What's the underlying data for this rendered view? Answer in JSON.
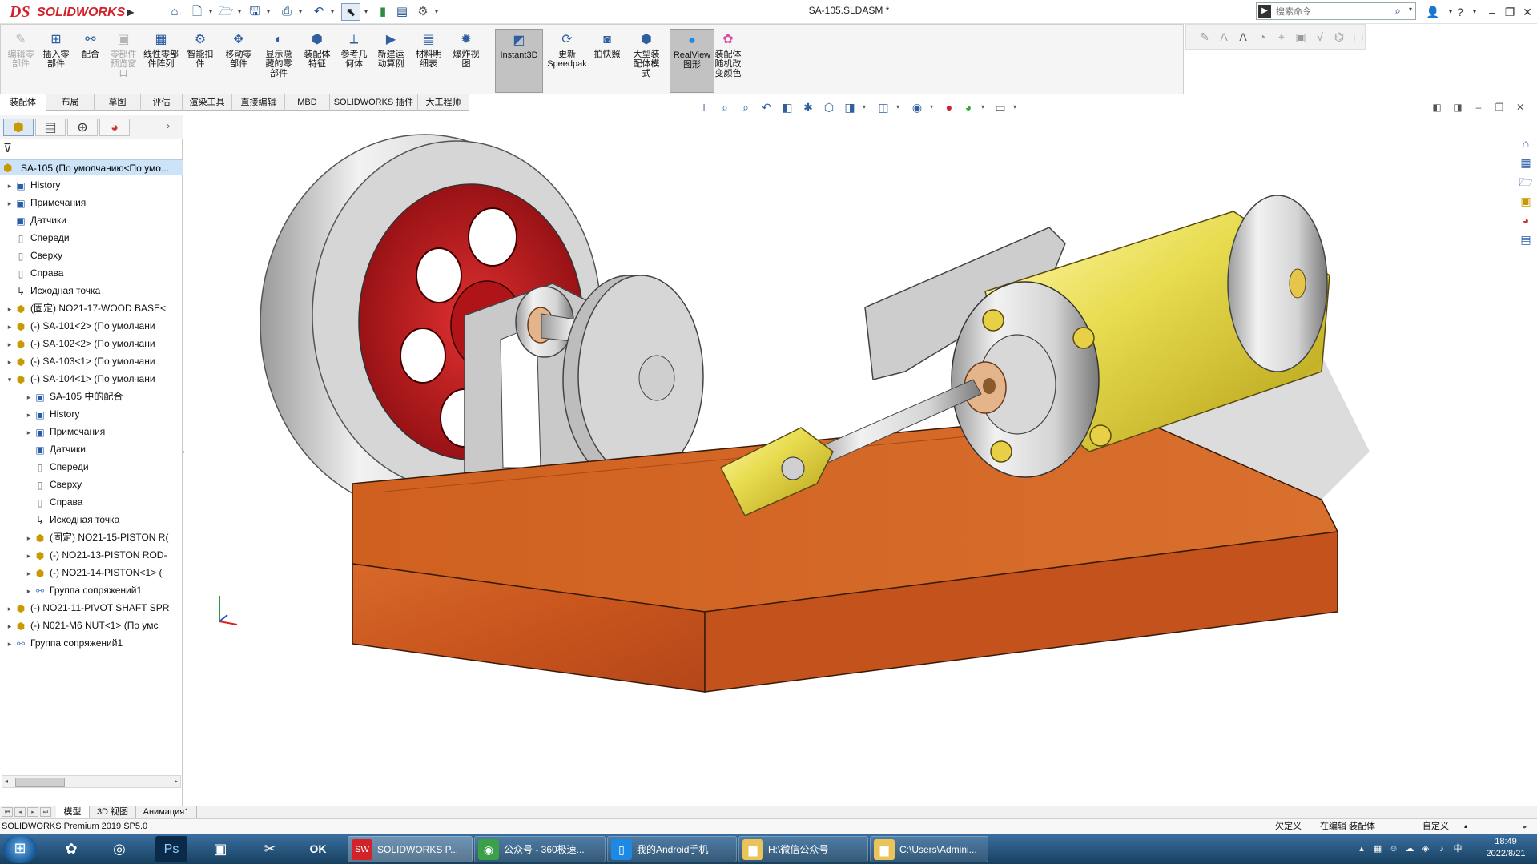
{
  "window": {
    "brand_ds": "DS",
    "brand_name": "SOLIDWORKS",
    "document_title": "SA-105.SLDASM *",
    "search_placeholder": "搜索命令"
  },
  "command_manager": {
    "buttons": [
      {
        "label": "编辑零\n部件",
        "icon": "edit-component-icon",
        "disabled": true
      },
      {
        "label": "插入零\n部件",
        "icon": "insert-component-icon",
        "disabled": false
      },
      {
        "label": "配合",
        "icon": "mate-icon",
        "disabled": false
      },
      {
        "label": "零部件\n预览窗\n口",
        "icon": "component-preview-icon",
        "disabled": true
      },
      {
        "label": "线性零部\n件阵列",
        "icon": "linear-pattern-icon",
        "disabled": false
      },
      {
        "label": "智能扣\n件",
        "icon": "smart-fasteners-icon",
        "disabled": false
      },
      {
        "label": "移动零\n部件",
        "icon": "move-component-icon",
        "disabled": false
      },
      {
        "label": "显示隐\n藏的零\n部件",
        "icon": "show-hidden-icon",
        "disabled": false
      },
      {
        "label": "装配体\n特征",
        "icon": "assembly-features-icon",
        "disabled": false
      },
      {
        "label": "参考几\n何体",
        "icon": "reference-geometry-icon",
        "disabled": false
      },
      {
        "label": "新建运\n动算例",
        "icon": "motion-study-icon",
        "disabled": false
      },
      {
        "label": "材料明\n细表",
        "icon": "bom-icon",
        "disabled": false
      },
      {
        "label": "爆炸视\n图",
        "icon": "exploded-view-icon",
        "disabled": false
      },
      {
        "label": "Instant3D",
        "icon": "instant3d-icon",
        "disabled": false,
        "active": true
      },
      {
        "label": "更新\nSpeedpak",
        "icon": "speedpak-icon",
        "disabled": false
      },
      {
        "label": "拍快照",
        "icon": "snapshot-icon",
        "disabled": false
      },
      {
        "label": "大型装\n配体模\n式",
        "icon": "large-assembly-icon",
        "disabled": false
      },
      {
        "label": "RealView\n图形",
        "icon": "realview-icon",
        "disabled": false,
        "active": true
      },
      {
        "label": "装配体\n随机改\n变颜色",
        "icon": "random-color-icon",
        "disabled": false
      }
    ]
  },
  "tabs": [
    "装配体",
    "布局",
    "草图",
    "评估",
    "渲染工具",
    "直接编辑",
    "MBD",
    "SOLIDWORKS 插件",
    "大工程师"
  ],
  "feature_tree": {
    "root": "SA-105  (По умолчанию<По умо...",
    "items": [
      {
        "label": "History",
        "icon": "folder",
        "level": 1,
        "exp": "▸"
      },
      {
        "label": "Примечания",
        "icon": "folder",
        "level": 1,
        "exp": "▸"
      },
      {
        "label": "Датчики",
        "icon": "folder",
        "level": 1,
        "exp": ""
      },
      {
        "label": "Спереди",
        "icon": "plane",
        "level": 1,
        "exp": ""
      },
      {
        "label": "Сверху",
        "icon": "plane",
        "level": 1,
        "exp": ""
      },
      {
        "label": "Справа",
        "icon": "plane",
        "level": 1,
        "exp": ""
      },
      {
        "label": "Исходная точка",
        "icon": "origin",
        "level": 1,
        "exp": ""
      },
      {
        "label": "(固定) NO21-17-WOOD BASE<",
        "icon": "part",
        "level": 1,
        "exp": "▸"
      },
      {
        "label": "(-) SA-101<2> (По умолчани",
        "icon": "asm",
        "level": 1,
        "exp": "▸"
      },
      {
        "label": "(-) SA-102<2> (По умолчани",
        "icon": "asm",
        "level": 1,
        "exp": "▸"
      },
      {
        "label": "(-) SA-103<1> (По умолчани",
        "icon": "asm",
        "level": 1,
        "exp": "▸"
      },
      {
        "label": "(-) SA-104<1> (По умолчани",
        "icon": "asm",
        "level": 1,
        "exp": "▾"
      },
      {
        "label": "SA-105 中的配合",
        "icon": "folder",
        "level": 2,
        "exp": "▸"
      },
      {
        "label": "History",
        "icon": "folder",
        "level": 2,
        "exp": "▸"
      },
      {
        "label": "Примечания",
        "icon": "folder",
        "level": 2,
        "exp": "▸"
      },
      {
        "label": "Датчики",
        "icon": "folder",
        "level": 2,
        "exp": ""
      },
      {
        "label": "Спереди",
        "icon": "plane",
        "level": 2,
        "exp": ""
      },
      {
        "label": "Сверху",
        "icon": "plane",
        "level": 2,
        "exp": ""
      },
      {
        "label": "Справа",
        "icon": "plane",
        "level": 2,
        "exp": ""
      },
      {
        "label": "Исходная точка",
        "icon": "origin",
        "level": 2,
        "exp": ""
      },
      {
        "label": "(固定) NO21-15-PISTON R(",
        "icon": "part",
        "level": 2,
        "exp": "▸"
      },
      {
        "label": "(-) NO21-13-PISTON ROD-",
        "icon": "part",
        "level": 2,
        "exp": "▸"
      },
      {
        "label": "(-) NO21-14-PISTON<1> (",
        "icon": "part",
        "level": 2,
        "exp": "▸"
      },
      {
        "label": "Группа сопряжений1",
        "icon": "mate",
        "level": 2,
        "exp": "▸"
      },
      {
        "label": "(-) NO21-11-PIVOT SHAFT SPR",
        "icon": "part",
        "level": 1,
        "exp": "▸"
      },
      {
        "label": "(-) N021-M6 NUT<1> (По умс",
        "icon": "part",
        "level": 1,
        "exp": "▸"
      },
      {
        "label": "Группа сопряжений1",
        "icon": "mate",
        "level": 1,
        "exp": "▸"
      }
    ]
  },
  "bottom_tabs": [
    "模型",
    "3D 视图",
    "Анимация1"
  ],
  "status": {
    "product": "SOLIDWORKS Premium 2019 SP5.0",
    "state": "欠定义",
    "mode": "在编辑 装配体",
    "units": "自定义"
  },
  "taskbar": {
    "windows": [
      {
        "label": "SOLIDWORKS P...",
        "icon": "solidworks-icon",
        "color": "#d2232a",
        "active": true
      },
      {
        "label": "公众号 - 360极速...",
        "icon": "browser-icon",
        "color": "#3aa04a",
        "active": false
      },
      {
        "label": "我的Android手机",
        "icon": "phone-icon",
        "color": "#1e88e5",
        "active": false
      },
      {
        "label": "H:\\微信公众号",
        "icon": "folder-icon",
        "color": "#e8c45a",
        "active": false
      },
      {
        "label": "C:\\Users\\Admini...",
        "icon": "folder-icon",
        "color": "#e8c45a",
        "active": false
      }
    ],
    "time": "18:49",
    "date": "2022/8/21"
  }
}
